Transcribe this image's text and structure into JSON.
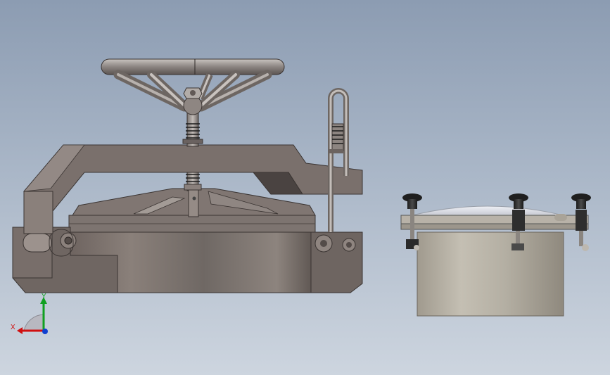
{
  "viewport": {
    "background_top": "#8c9cb2",
    "background_bottom": "#cdd5df"
  },
  "models": [
    {
      "name": "manhole-cover-with-handwheel-clamp",
      "view": "front"
    },
    {
      "name": "manhole-cover-with-knob-clamps",
      "view": "front"
    }
  ],
  "triad": {
    "x_label": "X",
    "y_label": "Y",
    "x_color": "#d01010",
    "y_color": "#10a020",
    "z_color": "#1040d0"
  }
}
